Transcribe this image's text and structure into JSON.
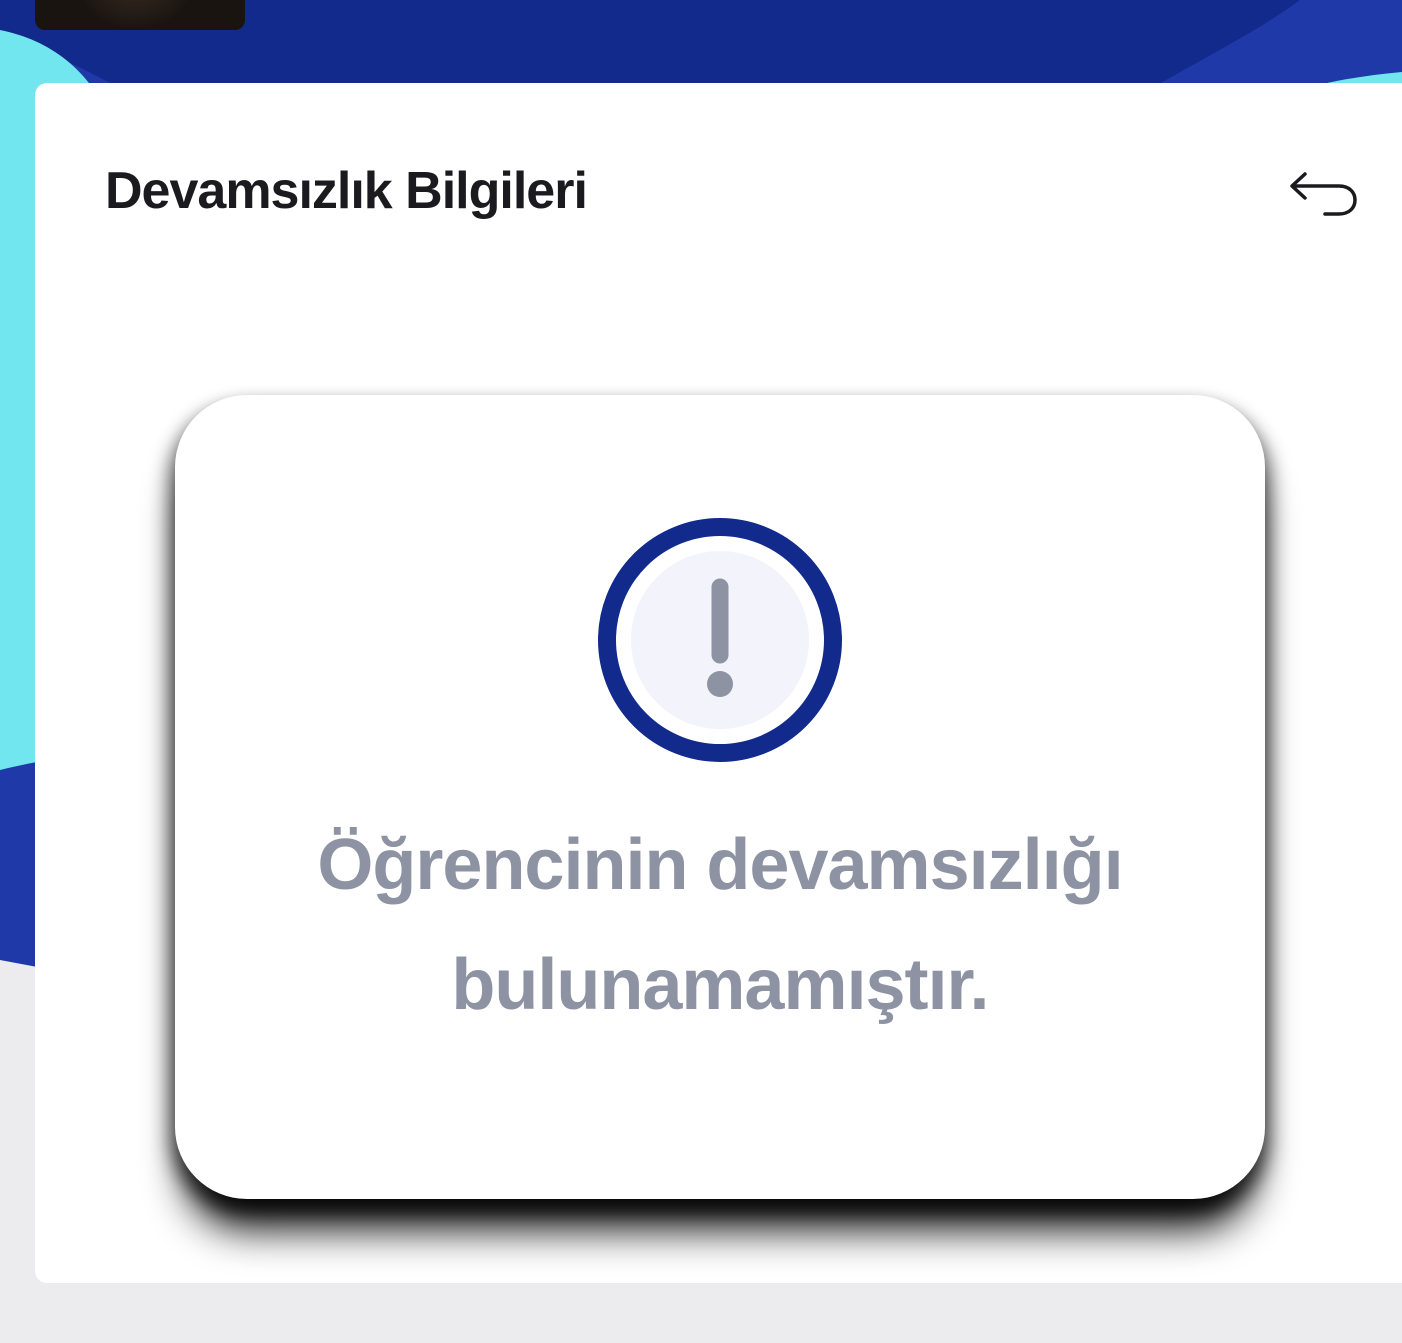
{
  "card": {
    "title": "Devamsızlık Bilgileri",
    "back_icon": "back-arrow-icon"
  },
  "empty_state": {
    "icon": "exclamation-circle-icon",
    "message": "Öğrencinin devamsızlığı bulunamamıştır."
  },
  "colors": {
    "navy": "#112a8c",
    "blue": "#1f3aa8",
    "cyan": "#72e6ee",
    "message_gray": "#8e93a3",
    "icon_fill": "#f2f3fb"
  }
}
